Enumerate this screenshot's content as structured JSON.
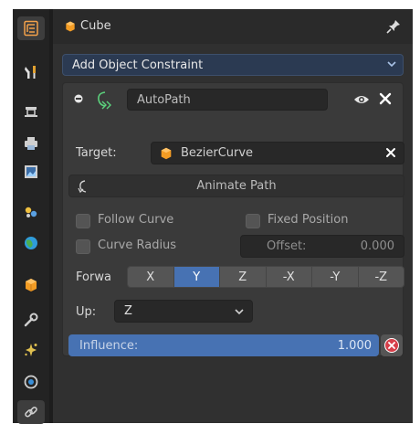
{
  "sidebar": {
    "tabs": [
      {
        "name": "tool",
        "icon": "outliner-icon",
        "color": "#f3a14a",
        "active": true
      },
      {
        "name": "tool-settings",
        "icon": "tools-icon",
        "color": "#e0e0e0"
      },
      {
        "name": "render",
        "icon": "render-icon",
        "color": "#cfcfcf"
      },
      {
        "name": "output",
        "icon": "printer-icon",
        "color": "#cfcfcf"
      },
      {
        "name": "view-layer",
        "icon": "image-icon",
        "color": "#cfcfcf"
      },
      {
        "name": "scene",
        "icon": "scene-icon",
        "color": "#f0c040"
      },
      {
        "name": "world",
        "icon": "world-icon",
        "color": "#2f9cdb"
      },
      {
        "name": "object",
        "icon": "cube-icon",
        "color": "#f39c24"
      },
      {
        "name": "modifiers",
        "icon": "wrench-icon",
        "color": "#cfcfcf"
      },
      {
        "name": "particles",
        "icon": "particles-icon",
        "color": "#e0c050"
      },
      {
        "name": "physics",
        "icon": "physics-icon",
        "color": "#3a8fd8"
      },
      {
        "name": "constraints",
        "icon": "constraint-icon",
        "color": "#cfcfcf"
      }
    ]
  },
  "header": {
    "object_name": "Cube"
  },
  "add_constraint": {
    "label": "Add Object Constraint"
  },
  "constraint": {
    "name": "AutoPath",
    "target_label": "Target:",
    "target_value": "BezierCurve",
    "animate_path_label": "Animate Path",
    "follow_curve_label": "Follow Curve",
    "fixed_position_label": "Fixed Position",
    "curve_radius_label": "Curve Radius",
    "offset_label": "Offset:",
    "offset_value": "0.000",
    "forward_label": "Forwa",
    "forward_options": [
      "X",
      "Y",
      "Z",
      "-X",
      "-Y",
      "-Z"
    ],
    "forward_selected": "Y",
    "up_label": "Up:",
    "up_value": "Z",
    "influence_label": "Influence:",
    "influence_value": "1.000",
    "influence_fraction": 1.0
  },
  "colors": {
    "accent": "#4772b3",
    "object_orange": "#f39c24"
  }
}
